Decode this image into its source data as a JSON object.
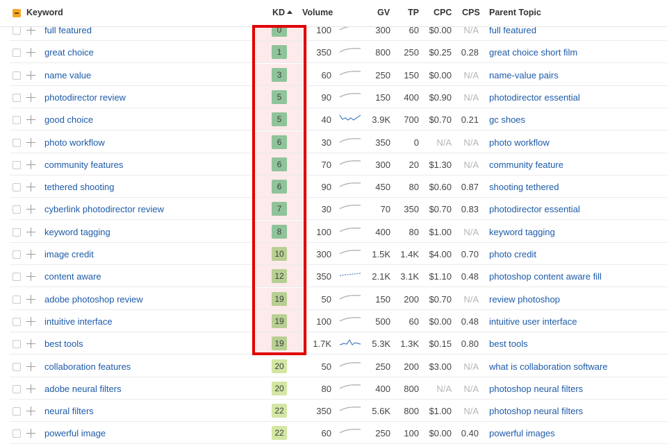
{
  "header": {
    "keyword": "Keyword",
    "kd": "KD",
    "volume": "Volume",
    "gv": "GV",
    "tp": "TP",
    "cpc": "CPC",
    "cps": "CPS",
    "parent_topic": "Parent Topic"
  },
  "kd_colors": {
    "low": "#8fc49a",
    "mid": "#b7cf92",
    "high": "#d3e6a3"
  },
  "rows": [
    {
      "keyword": "full featured",
      "kd": "0",
      "volume": "100",
      "gv": "300",
      "tp": "60",
      "cpc": "$0.00",
      "cps": "N/A",
      "parent": "full featured",
      "trend": "flat"
    },
    {
      "keyword": "great choice",
      "kd": "1",
      "volume": "350",
      "gv": "800",
      "tp": "250",
      "cpc": "$0.25",
      "cps": "0.28",
      "parent": "great choice short film",
      "trend": "flat"
    },
    {
      "keyword": "name value",
      "kd": "3",
      "volume": "60",
      "gv": "250",
      "tp": "150",
      "cpc": "$0.00",
      "cps": "N/A",
      "parent": "name-value pairs",
      "trend": "flat"
    },
    {
      "keyword": "photodirector review",
      "kd": "5",
      "volume": "90",
      "gv": "150",
      "tp": "400",
      "cpc": "$0.90",
      "cps": "N/A",
      "parent": "photodirector essential",
      "trend": "flat"
    },
    {
      "keyword": "good choice",
      "kd": "5",
      "volume": "40",
      "gv": "3.9K",
      "tp": "700",
      "cpc": "$0.70",
      "cps": "0.21",
      "parent": "gc shoes",
      "trend": "wavy"
    },
    {
      "keyword": "photo workflow",
      "kd": "6",
      "volume": "30",
      "gv": "350",
      "tp": "0",
      "cpc": "N/A",
      "cps": "N/A",
      "parent": "photo workflow",
      "trend": "flat"
    },
    {
      "keyword": "community features",
      "kd": "6",
      "volume": "70",
      "gv": "300",
      "tp": "20",
      "cpc": "$1.30",
      "cps": "N/A",
      "parent": "community feature",
      "trend": "flat"
    },
    {
      "keyword": "tethered shooting",
      "kd": "6",
      "volume": "90",
      "gv": "450",
      "tp": "80",
      "cpc": "$0.60",
      "cps": "0.87",
      "parent": "shooting tethered",
      "trend": "flat"
    },
    {
      "keyword": "cyberlink photodirector review",
      "kd": "7",
      "volume": "30",
      "gv": "70",
      "tp": "350",
      "cpc": "$0.70",
      "cps": "0.83",
      "parent": "photodirector essential",
      "trend": "flat"
    },
    {
      "keyword": "keyword tagging",
      "kd": "8",
      "volume": "100",
      "gv": "400",
      "tp": "80",
      "cpc": "$1.00",
      "cps": "N/A",
      "parent": "keyword tagging",
      "trend": "flat"
    },
    {
      "keyword": "image credit",
      "kd": "10",
      "volume": "300",
      "gv": "1.5K",
      "tp": "1.4K",
      "cpc": "$4.00",
      "cps": "0.70",
      "parent": "photo credit",
      "trend": "flat"
    },
    {
      "keyword": "content aware",
      "kd": "12",
      "volume": "350",
      "gv": "2.1K",
      "tp": "3.1K",
      "cpc": "$1.10",
      "cps": "0.48",
      "parent": "photoshop content aware fill",
      "trend": "dotted"
    },
    {
      "keyword": "adobe photoshop review",
      "kd": "19",
      "volume": "50",
      "gv": "150",
      "tp": "200",
      "cpc": "$0.70",
      "cps": "N/A",
      "parent": "review photoshop",
      "trend": "flat"
    },
    {
      "keyword": "intuitive interface",
      "kd": "19",
      "volume": "100",
      "gv": "500",
      "tp": "60",
      "cpc": "$0.00",
      "cps": "0.48",
      "parent": "intuitive user interface",
      "trend": "flat"
    },
    {
      "keyword": "best tools",
      "kd": "19",
      "volume": "1.7K",
      "gv": "5.3K",
      "tp": "1.3K",
      "cpc": "$0.15",
      "cps": "0.80",
      "parent": "best tools",
      "trend": "peak"
    },
    {
      "keyword": "collaboration features",
      "kd": "20",
      "volume": "50",
      "gv": "250",
      "tp": "200",
      "cpc": "$3.00",
      "cps": "N/A",
      "parent": "what is collaboration software",
      "trend": "flat"
    },
    {
      "keyword": "adobe neural filters",
      "kd": "20",
      "volume": "80",
      "gv": "400",
      "tp": "800",
      "cpc": "N/A",
      "cps": "N/A",
      "parent": "photoshop neural filters",
      "trend": "flat"
    },
    {
      "keyword": "neural filters",
      "kd": "22",
      "volume": "350",
      "gv": "5.6K",
      "tp": "800",
      "cpc": "$1.00",
      "cps": "N/A",
      "parent": "photoshop neural filters",
      "trend": "flat"
    },
    {
      "keyword": "powerful image",
      "kd": "22",
      "volume": "60",
      "gv": "250",
      "tp": "100",
      "cpc": "$0.00",
      "cps": "0.40",
      "parent": "powerful images",
      "trend": "flat"
    }
  ]
}
